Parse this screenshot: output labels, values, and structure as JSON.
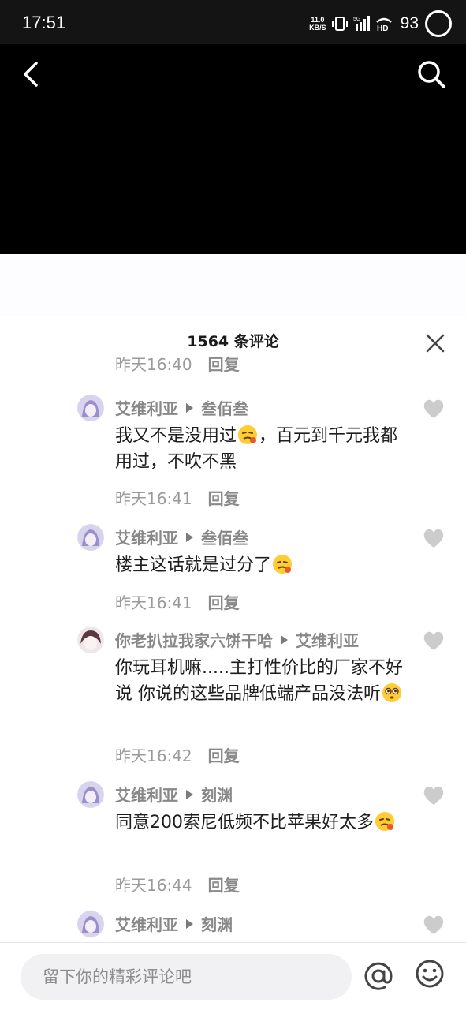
{
  "status_bar": {
    "time": "17:51",
    "net_speed_value": "11.0",
    "net_speed_unit": "KB/S",
    "network_label": "5G",
    "battery": "93"
  },
  "video": {
    "back_icon": "chevron-left-icon",
    "search_icon": "search-icon"
  },
  "sheet": {
    "title": "1564 条评论",
    "close_icon": "close-icon"
  },
  "comments": [
    {
      "author": "",
      "reply_to": "",
      "text": "",
      "time": "昨天16:40",
      "reply_label": "回复"
    },
    {
      "author": "艾维利亚",
      "reply_to": "叁佰叁",
      "text_before": "我又不是没用过",
      "emoji": "sneer-emoji",
      "text_after": "，百元到千元我都用过，不吹不黑",
      "time": "昨天16:41",
      "reply_label": "回复"
    },
    {
      "author": "艾维利亚",
      "reply_to": "叁佰叁",
      "text_before": "楼主这话就是过分了",
      "emoji": "sneer-emoji",
      "text_after": "",
      "time": "昨天16:41",
      "reply_label": "回复"
    },
    {
      "author": "你老扒拉我家六饼干哈",
      "reply_to": "艾维利亚",
      "text_before": "你玩耳机嘛.....主打性价比的厂家不好说 你说的这些品牌低端产品没法听",
      "emoji": "flushed-emoji",
      "text_after": "",
      "time": "昨天16:42",
      "reply_label": "回复"
    },
    {
      "author": "艾维利亚",
      "reply_to": "刻渊",
      "text_before": "同意200索尼低频不比苹果好太多",
      "emoji": "sneer-emoji",
      "text_after": "",
      "time": "昨天16:44",
      "reply_label": "回复"
    },
    {
      "author": "艾维利亚",
      "reply_to": "刻渊",
      "text_before": "",
      "emoji": "",
      "text_after": "",
      "time": "",
      "reply_label": ""
    }
  ],
  "input_bar": {
    "placeholder": "留下你的精彩评论吧",
    "at_icon": "at-icon",
    "emoji_icon": "smiley-icon"
  },
  "colors": {
    "status_bg": "#141414",
    "video_bg": "#000000",
    "sheet_bg": "#ffffff",
    "author_gray": "#888888",
    "meta_gray": "#9a9a9a",
    "heart_gray": "#cccccc"
  }
}
